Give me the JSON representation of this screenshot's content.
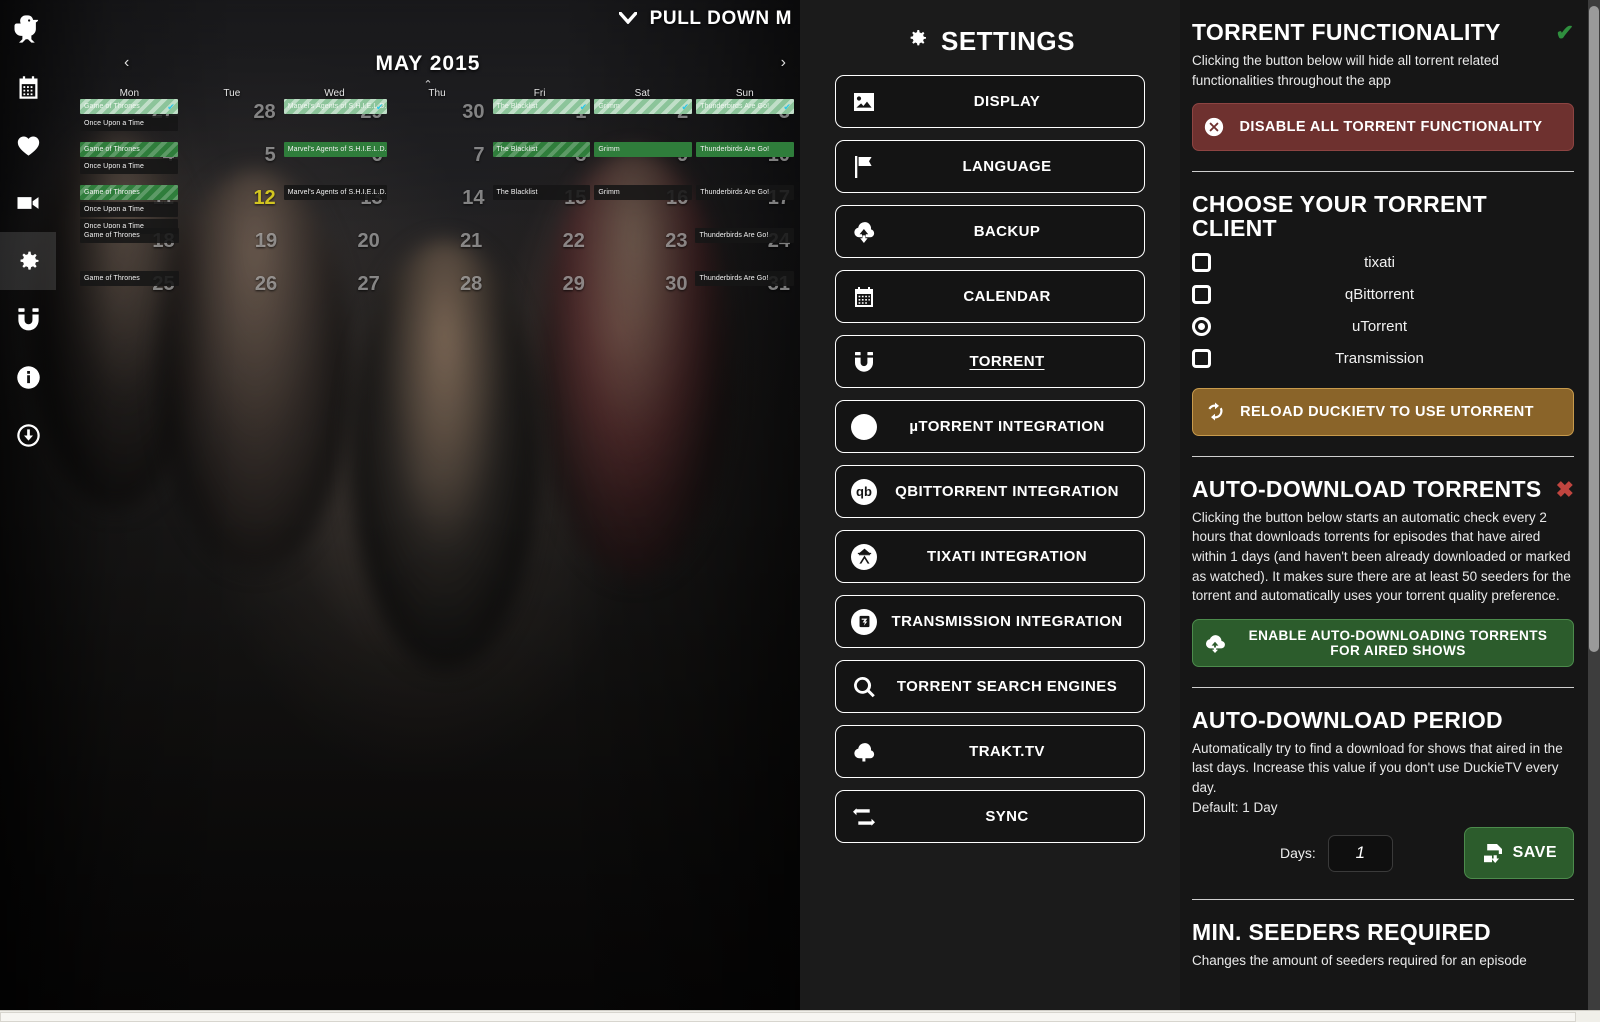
{
  "sidebar": {
    "logo": "duckietv-logo-icon",
    "items": [
      {
        "name": "calendar",
        "icon": "calendar-icon",
        "active": false
      },
      {
        "name": "favorites",
        "icon": "heart-icon",
        "active": false
      },
      {
        "name": "watchlist",
        "icon": "video-camera-icon",
        "active": false
      },
      {
        "name": "settings",
        "icon": "gear-icon",
        "active": true
      },
      {
        "name": "torrent",
        "icon": "magnet-icon",
        "active": false
      },
      {
        "name": "about",
        "icon": "info-icon",
        "active": false
      },
      {
        "name": "downloads",
        "icon": "download-icon",
        "active": false
      }
    ]
  },
  "calendar": {
    "pull_down_label": "PULL DOWN M",
    "month_title": "MAY 2015",
    "prev_label": "‹",
    "next_label": "›",
    "collapse_label": "⌃",
    "day_headers": [
      "Mon",
      "Tue",
      "Wed",
      "Thu",
      "Fri",
      "Sat",
      "Sun"
    ],
    "weeks": [
      [
        {
          "num": "27",
          "events": [
            {
              "title": "Game of Thrones",
              "style": "pale",
              "downloaded": true
            },
            {
              "title": "Once Upon a Time",
              "style": "plain",
              "downloaded": false
            }
          ]
        },
        {
          "num": "28",
          "events": []
        },
        {
          "num": "29",
          "events": [
            {
              "title": "Marvel's Agents of S.H.I.E.L.D.",
              "style": "pale",
              "downloaded": true
            }
          ]
        },
        {
          "num": "30",
          "events": []
        },
        {
          "num": "1",
          "events": [
            {
              "title": "The Blacklist",
              "style": "pale",
              "downloaded": true
            }
          ]
        },
        {
          "num": "2",
          "events": [
            {
              "title": "Grimm",
              "style": "pale",
              "downloaded": true
            }
          ]
        },
        {
          "num": "3",
          "events": [
            {
              "title": "Thunderbirds Are Go!",
              "style": "pale",
              "downloaded": true
            }
          ]
        }
      ],
      [
        {
          "num": "4",
          "events": [
            {
              "title": "Game of Thrones",
              "style": "stripe",
              "downloaded": false
            },
            {
              "title": "Once Upon a Time",
              "style": "plain",
              "downloaded": false
            }
          ]
        },
        {
          "num": "5",
          "events": []
        },
        {
          "num": "6",
          "events": [
            {
              "title": "Marvel's Agents of S.H.I.E.L.D.",
              "style": "green",
              "downloaded": false
            }
          ]
        },
        {
          "num": "7",
          "events": []
        },
        {
          "num": "8",
          "events": [
            {
              "title": "The Blacklist",
              "style": "stripe",
              "downloaded": false
            }
          ]
        },
        {
          "num": "9",
          "events": [
            {
              "title": "Grimm",
              "style": "green",
              "downloaded": false
            }
          ]
        },
        {
          "num": "10",
          "events": [
            {
              "title": "Thunderbirds Are Go!",
              "style": "green",
              "downloaded": false
            }
          ]
        }
      ],
      [
        {
          "num": "11",
          "events": [
            {
              "title": "Game of Thrones",
              "style": "stripe",
              "downloaded": false
            },
            {
              "title": "Once Upon a Time",
              "style": "plain",
              "downloaded": false
            },
            {
              "title": "Once Upon a Time",
              "style": "plain",
              "downloaded": false
            }
          ]
        },
        {
          "num": "12",
          "today": true,
          "events": []
        },
        {
          "num": "13",
          "events": [
            {
              "title": "Marvel's Agents of S.H.I.E.L.D.",
              "style": "plain",
              "downloaded": false
            }
          ]
        },
        {
          "num": "14",
          "events": []
        },
        {
          "num": "15",
          "events": [
            {
              "title": "The Blacklist",
              "style": "plain",
              "downloaded": false
            }
          ]
        },
        {
          "num": "16",
          "events": [
            {
              "title": "Grimm",
              "style": "plain",
              "downloaded": false
            }
          ]
        },
        {
          "num": "17",
          "events": [
            {
              "title": "Thunderbirds Are Go!",
              "style": "plain",
              "downloaded": false
            }
          ]
        }
      ],
      [
        {
          "num": "18",
          "events": [
            {
              "title": "Game of Thrones",
              "style": "plain",
              "downloaded": false
            }
          ]
        },
        {
          "num": "19",
          "events": []
        },
        {
          "num": "20",
          "events": []
        },
        {
          "num": "21",
          "events": []
        },
        {
          "num": "22",
          "events": []
        },
        {
          "num": "23",
          "events": []
        },
        {
          "num": "24",
          "events": [
            {
              "title": "Thunderbirds Are Go!",
              "style": "plain",
              "downloaded": false
            }
          ]
        }
      ],
      [
        {
          "num": "25",
          "events": [
            {
              "title": "Game of Thrones",
              "style": "plain",
              "downloaded": false
            }
          ]
        },
        {
          "num": "26",
          "events": []
        },
        {
          "num": "27",
          "events": []
        },
        {
          "num": "28",
          "events": []
        },
        {
          "num": "29",
          "events": []
        },
        {
          "num": "30",
          "events": []
        },
        {
          "num": "31",
          "events": [
            {
              "title": "Thunderbirds Are Go!",
              "style": "plain",
              "downloaded": false
            }
          ]
        }
      ]
    ]
  },
  "settings_menu": {
    "title": "SETTINGS",
    "title_icon": "gear-icon",
    "items": [
      {
        "label": "DISPLAY",
        "icon": "image-icon",
        "current": false
      },
      {
        "label": "LANGUAGE",
        "icon": "flag-icon",
        "current": false
      },
      {
        "label": "BACKUP",
        "icon": "cloud-down-icon",
        "current": false
      },
      {
        "label": "CALENDAR",
        "icon": "calendar-icon",
        "current": false
      },
      {
        "label": "TORRENT",
        "icon": "magnet-icon",
        "current": true
      },
      {
        "label": "µTORRENT INTEGRATION",
        "icon": "utorrent-icon",
        "current": false
      },
      {
        "label": "QBITTORRENT INTEGRATION",
        "icon": "qbittorrent-icon",
        "current": false
      },
      {
        "label": "TIXATI INTEGRATION",
        "icon": "tixati-icon",
        "current": false
      },
      {
        "label": "TRANSMISSION INTEGRATION",
        "icon": "transmission-icon",
        "current": false
      },
      {
        "label": "TORRENT SEARCH ENGINES",
        "icon": "search-icon",
        "current": false
      },
      {
        "label": "TRAKT.TV",
        "icon": "cloud-up-icon",
        "current": false
      },
      {
        "label": "SYNC",
        "icon": "sync-icon",
        "current": false
      }
    ]
  },
  "content": {
    "torrent_functionality": {
      "heading": "TORRENT FUNCTIONALITY",
      "status_mark": "✔",
      "status_color": "#2f8f3e",
      "description": "Clicking the button below will hide all torrent related functionalities throughout the app",
      "button_label": "DISABLE ALL TORRENT FUNCTIONALITY",
      "button_icon": "disable-circle-icon",
      "button_color": "#6e312f"
    },
    "choose_client": {
      "heading": "CHOOSE YOUR TORRENT CLIENT",
      "options": [
        {
          "label": "tixati",
          "selected": false
        },
        {
          "label": "qBittorrent",
          "selected": false
        },
        {
          "label": "uTorrent",
          "selected": true
        },
        {
          "label": "Transmission",
          "selected": false
        }
      ],
      "reload_label": "RELOAD DUCKIETV TO USE UTORRENT",
      "reload_icon": "refresh-icon",
      "reload_color": "#8a6429"
    },
    "auto_download": {
      "heading": "AUTO-DOWNLOAD TORRENTS",
      "status_mark": "✖",
      "status_color": "#c0453f",
      "description": "Clicking the button below starts an automatic check every 2 hours that downloads torrents for episodes that have aired within 1 days (and haven't been already downloaded or marked as watched). It makes sure there are at least 50 seeders for the torrent and automatically uses your torrent quality preference.",
      "button_label": "ENABLE AUTO-DOWNLOADING TORRENTS FOR AIRED SHOWS",
      "button_icon": "cloud-down-icon",
      "button_color": "#2c5c2c"
    },
    "auto_download_period": {
      "heading": "AUTO-DOWNLOAD PERIOD",
      "description": "Automatically try to find a download for shows that aired in the last days. Increase this value if you don't use DuckieTV every day.",
      "default_line": "Default: 1 Day",
      "days_label": "Days:",
      "days_value": "1",
      "save_label": "SAVE",
      "save_icon": "save-icon"
    },
    "min_seeders": {
      "heading": "MIN. SEEDERS REQUIRED",
      "description": "Changes the amount of seeders required for an episode"
    }
  }
}
